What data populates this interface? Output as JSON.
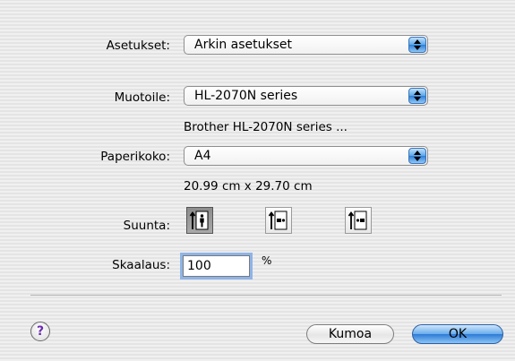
{
  "settings": {
    "label": "Asetukset:",
    "value": "Arkin asetukset"
  },
  "format_for": {
    "label": "Muotoile:",
    "value": "HL-2070N series",
    "description": "Brother HL-2070N series ..."
  },
  "paper_size": {
    "label": "Paperikoko:",
    "value": "A4",
    "dimensions": "20.99 cm x 29.70 cm"
  },
  "orientation": {
    "label": "Suunta:",
    "options": [
      {
        "name": "portrait",
        "icon": "portrait-orientation-icon",
        "selected": true
      },
      {
        "name": "landscape-left",
        "icon": "landscape-orientation-icon",
        "selected": false
      },
      {
        "name": "landscape-right",
        "icon": "reverse-landscape-orientation-icon",
        "selected": false
      }
    ]
  },
  "scale": {
    "label": "Skaalaus:",
    "value": "100",
    "unit": "%"
  },
  "buttons": {
    "help": "?",
    "cancel": "Kumoa",
    "ok": "OK"
  },
  "colors": {
    "accent": "#2d7ad6",
    "selected_orientation": "#8c8c8c",
    "help_glyph": "#6a2fb0"
  }
}
